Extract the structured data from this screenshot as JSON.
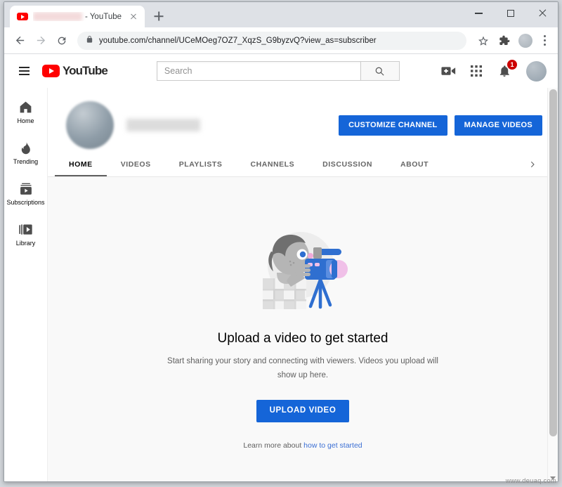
{
  "window": {
    "controls": {
      "minimize": "minimize",
      "maximize": "maximize",
      "close": "close"
    }
  },
  "tab": {
    "title_suffix": "- YouTube",
    "favicon": "youtube-favicon",
    "close_label": "Close tab",
    "new_tab_label": "New tab"
  },
  "toolbar": {
    "back": "back-arrow-icon",
    "forward": "forward-arrow-icon",
    "reload": "reload-icon",
    "lock": "lock-icon",
    "url": "youtube.com/channel/UCeMOeg7OZ7_XqzS_G9byzvQ?view_as=subscriber",
    "bookmark": "star-icon",
    "extensions": "puzzle-icon",
    "profile": "profile-avatar",
    "menu": "three-dot-menu"
  },
  "masthead": {
    "menu_label": "Guide",
    "logo_text": "YouTube",
    "search": {
      "placeholder": "Search",
      "button_label": "search-icon"
    },
    "create_label": "create-video-icon",
    "apps_label": "youtube-apps-icon",
    "notifications_label": "notifications-bell-icon",
    "notification_count": "1",
    "avatar_label": "account-avatar"
  },
  "guide": {
    "items": [
      {
        "label": "Home",
        "icon": "home-icon"
      },
      {
        "label": "Trending",
        "icon": "trending-flame-icon"
      },
      {
        "label": "Subscriptions",
        "icon": "subscriptions-icon"
      },
      {
        "label": "Library",
        "icon": "library-icon"
      }
    ]
  },
  "channel": {
    "avatar_label": "channel-avatar",
    "name": "",
    "buttons": {
      "customize": "CUSTOMIZE CHANNEL",
      "manage": "MANAGE VIDEOS"
    },
    "tabs": [
      {
        "label": "HOME",
        "active": true
      },
      {
        "label": "VIDEOS",
        "active": false
      },
      {
        "label": "PLAYLISTS",
        "active": false
      },
      {
        "label": "CHANNELS",
        "active": false
      },
      {
        "label": "DISCUSSION",
        "active": false
      },
      {
        "label": "ABOUT",
        "active": false
      }
    ],
    "tabs_more": "chevron-right-icon"
  },
  "empty_state": {
    "illustration": "videographer-illustration",
    "title": "Upload a video to get started",
    "subtitle": "Start sharing your story and connecting with viewers. Videos you upload will show up here.",
    "upload_button": "UPLOAD VIDEO",
    "learn_more_prefix": "Learn more about ",
    "learn_more_link": "how to get started"
  },
  "colors": {
    "accent_blue": "#1565d8",
    "youtube_red": "#ff0000",
    "badge_red": "#cc0000",
    "content_bg": "#f9f9f9",
    "link_blue": "#3b6fd4"
  },
  "watermark": "www.deuaq.com"
}
